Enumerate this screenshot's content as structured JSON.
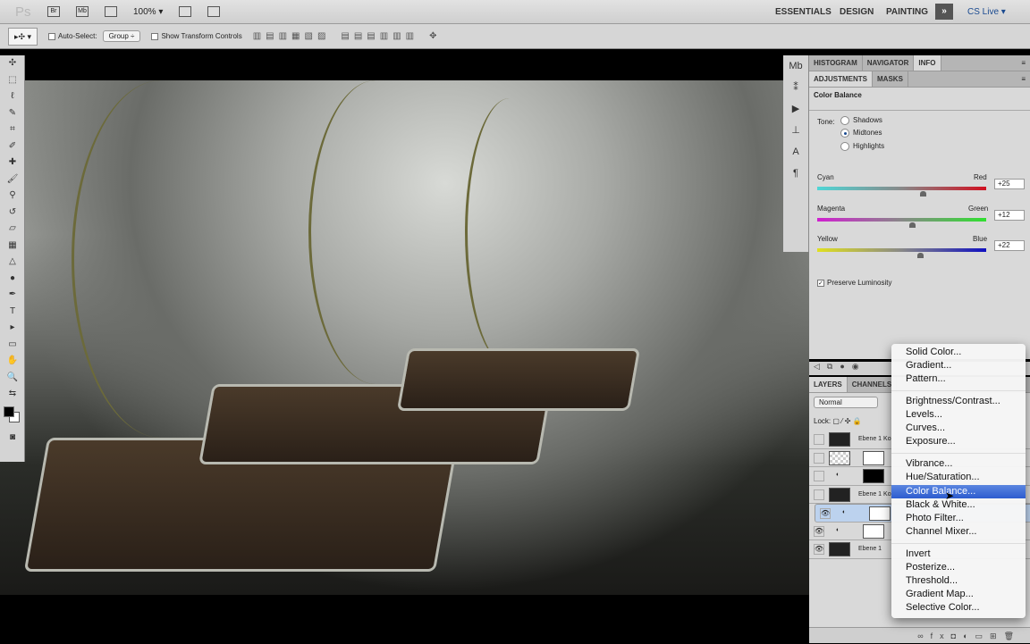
{
  "appbar": {
    "logo": "Ps",
    "bridge": "Br",
    "minibridge": "Mb",
    "zoom": "100% ▾",
    "workspaces": [
      "ESSENTIALS",
      "DESIGN",
      "PAINTING"
    ],
    "more": "»",
    "cslive": "CS Live ▾"
  },
  "options": {
    "tool": "▸✣ ▾",
    "auto_select": "Auto-Select:",
    "auto_select_value": "Group ÷",
    "show_transform": "Show Transform Controls"
  },
  "top_tabs": [
    "HISTOGRAM",
    "NAVIGATOR",
    "INFO"
  ],
  "adj_tabs": [
    "ADJUSTMENTS",
    "MASKS"
  ],
  "adjustment": {
    "title": "Color Balance",
    "tone_label": "Tone:",
    "tones": [
      "Shadows",
      "Midtones",
      "Highlights"
    ],
    "selected_tone": "Midtones",
    "sliders": [
      {
        "left": "Cyan",
        "right": "Red",
        "value": "+25",
        "pos": 25
      },
      {
        "left": "Magenta",
        "right": "Green",
        "value": "+12",
        "pos": 12
      },
      {
        "left": "Yellow",
        "right": "Blue",
        "value": "+22",
        "pos": 22
      }
    ],
    "preserve": "Preserve Luminosity"
  },
  "layers": {
    "tabs": [
      "LAYERS",
      "CHANNELS"
    ],
    "blend": "Normal",
    "lock": "Lock:",
    "items": [
      {
        "name": "Ebene 1 Ko"
      },
      {
        "name": ""
      },
      {
        "name": ""
      },
      {
        "name": "Ebene 1 Ko"
      },
      {
        "name": ""
      },
      {
        "name": ""
      },
      {
        "name": "Ebene 1"
      }
    ]
  },
  "menu": {
    "items": [
      "Solid Color...",
      "Gradient...",
      "Pattern...",
      "Brightness/Contrast...",
      "Levels...",
      "Curves...",
      "Exposure...",
      "Vibrance...",
      "Hue/Saturation...",
      "Color Balance...",
      "Black & White...",
      "Photo Filter...",
      "Channel Mixer...",
      "Invert",
      "Posterize...",
      "Threshold...",
      "Gradient Map...",
      "Selective Color..."
    ],
    "highlighted": "Color Balance..."
  },
  "colors": {
    "highlight": "#3d6fd8"
  }
}
